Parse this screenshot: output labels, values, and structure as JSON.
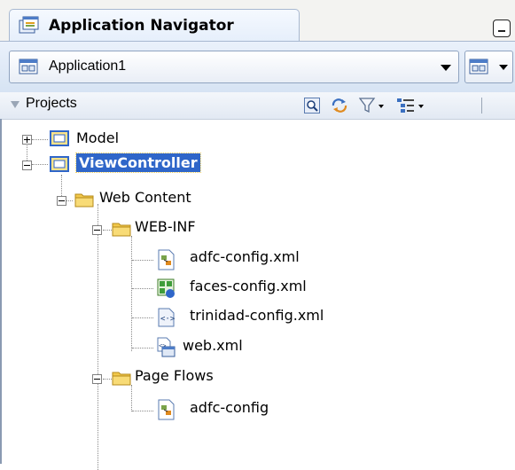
{
  "panel": {
    "title": "Application Navigator"
  },
  "app_selector": {
    "selected": "Application1"
  },
  "projects": {
    "header_label": "Projects"
  },
  "tree": {
    "model": "Model",
    "view_controller": "ViewController",
    "web_content": "Web Content",
    "web_inf": "WEB-INF",
    "adfc_config_xml": "adfc-config.xml",
    "faces_config_xml": "faces-config.xml",
    "trinidad_config_xml": "trinidad-config.xml",
    "web_xml": "web.xml",
    "page_flows": "Page Flows",
    "adfc_config": "adfc-config"
  },
  "colors": {
    "selection": "#2f66c9",
    "folder": "#f2c84b",
    "project_folder_border": "#2f66c9"
  }
}
